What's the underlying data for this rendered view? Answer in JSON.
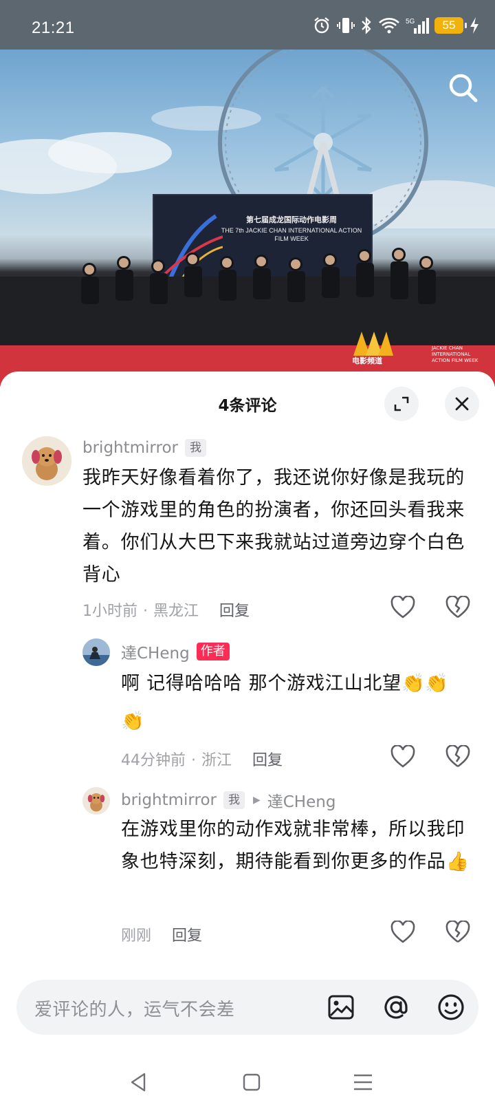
{
  "status_bar": {
    "time": "21:21",
    "network": "5G",
    "battery": "55"
  },
  "video": {
    "poster_title_cn": "第七届成龙国际动作电影周",
    "poster_title_en": "THE 7th JACKIE CHAN INTERNATIONAL ACTION FILM WEEK",
    "channel_logo": "电影频道",
    "festival_logo": "JACKIE CHAN INTERNATIONAL ACTION FILM WEEK"
  },
  "comments_panel": {
    "title": "4条评论",
    "comments": [
      {
        "username": "brightmirror",
        "tag": "我",
        "text": "我昨天好像看着你了，我还说你好像是我玩的一个游戏里的角色的扮演者，你还回头看我来着。你们从大巴下来我就站过道旁边穿个白色背心",
        "time": "1小时前",
        "location": "黑龙江",
        "reply_label": "回复"
      },
      {
        "username": "達CHeng",
        "tag": "作者",
        "text": "啊 记得哈哈哈 那个游戏江山北望👏👏👏",
        "time": "44分钟前",
        "location": "浙江",
        "reply_label": "回复"
      },
      {
        "username": "brightmirror",
        "tag": "我",
        "reply_to": "達CHeng",
        "text": "在游戏里你的动作戏就非常棒，所以我印象也特深刻，期待能看到你更多的作品👍",
        "time": "刚刚",
        "reply_label": "回复"
      }
    ]
  },
  "input": {
    "placeholder": "爱评论的人，运气不会差"
  },
  "colors": {
    "author_tag": "#fd2c55",
    "status_bar": "#5d6770",
    "battery": "#f2b20e"
  }
}
